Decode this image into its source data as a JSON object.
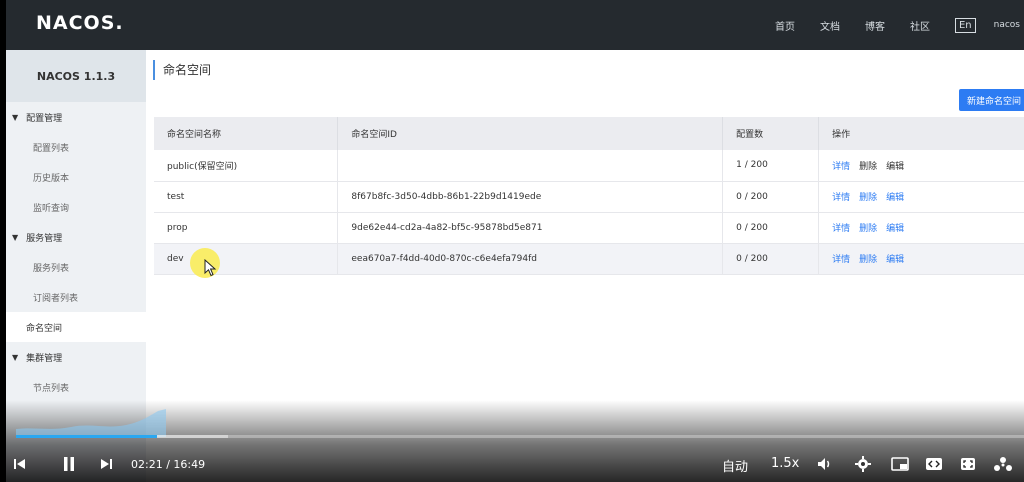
{
  "header": {
    "logo": "NACOS.",
    "nav": [
      "首页",
      "文档",
      "博客",
      "社区"
    ],
    "lang": "En",
    "user": "nacos"
  },
  "sidebar": {
    "version": "NACOS 1.1.3",
    "groups": [
      {
        "label": "配置管理",
        "items": [
          "配置列表",
          "历史版本",
          "监听查询"
        ]
      },
      {
        "label": "服务管理",
        "items": [
          "服务列表",
          "订阅者列表"
        ]
      },
      {
        "label": "集群管理",
        "items": [
          "节点列表"
        ]
      }
    ],
    "standalone": "命名空间"
  },
  "main": {
    "title": "命名空间",
    "new_button": "新建命名空间",
    "columns": [
      "命名空间名称",
      "命名空间ID",
      "配置数",
      "操作"
    ],
    "rows": [
      {
        "name": "public(保留空间)",
        "id": "",
        "count": "1 / 200"
      },
      {
        "name": "test",
        "id": "8f67b8fc-3d50-4dbb-86b1-22b9d1419ede",
        "count": "0 / 200"
      },
      {
        "name": "prop",
        "id": "9de62e44-cd2a-4a82-bf5c-95878bd5e871",
        "count": "0 / 200"
      },
      {
        "name": "dev",
        "id": "eea670a7-f4dd-40d0-870c-c6e4efa794fd",
        "count": "0 / 200"
      }
    ],
    "actions": [
      "详情",
      "删除",
      "编辑"
    ]
  },
  "player": {
    "time": "02:21 / 16:49",
    "auto": "自动",
    "speed": "1.5x",
    "progress": 0.14,
    "buffered": 0.21
  },
  "colors": {
    "accent": "#2d7cf3",
    "header_bg": "#252a2f",
    "progress": "#2aa7f0"
  }
}
